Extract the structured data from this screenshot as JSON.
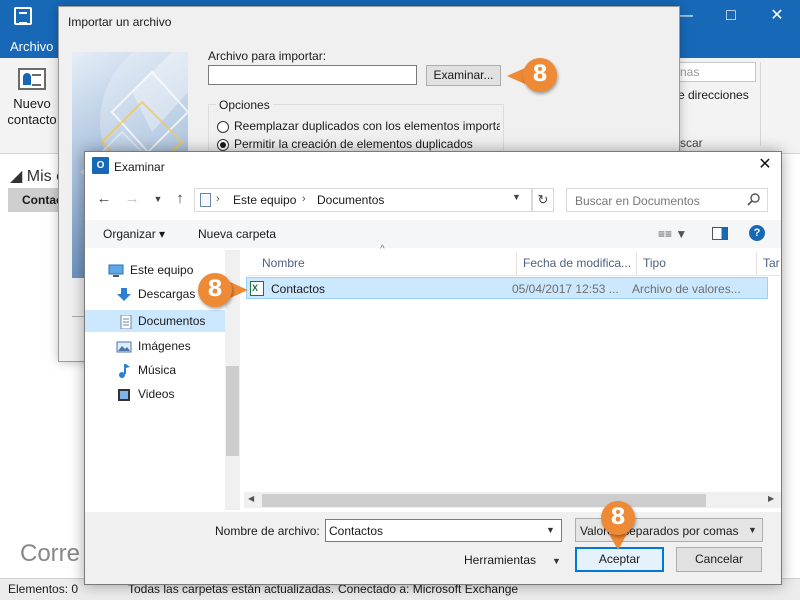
{
  "outlook": {
    "archivo_tab": "Archivo",
    "nuevo_contacto": "Nuevo contacto",
    "ribbon_search_placeholder": "nas",
    "ribbon_direcciones": "e direcciones",
    "ribbon_buscar": "scar",
    "nav_title": "Mis c",
    "nav_contactos": "Contac",
    "correo": "Corre",
    "status": {
      "elementos": "Elementos: 0",
      "carpetas": "Todas las carpetas están actualizadas.",
      "conectado": "Conectado a: Microsoft Exchange"
    }
  },
  "import_dialog": {
    "title": "Importar un archivo",
    "archivo_label": "Archivo para importar:",
    "archivo_value": "",
    "examinar": "Examinar...",
    "opciones": "Opciones",
    "radio1": "Reemplazar duplicados con los elementos importac",
    "radio2": "Permitir la creación de elementos duplicados"
  },
  "browse_dialog": {
    "title": "Examinar",
    "breadcrumb": [
      "Este equipo",
      "Documentos"
    ],
    "search_placeholder": "Buscar en Documentos",
    "toolbar": {
      "organizar": "Organizar ▾",
      "nueva_carpeta": "Nueva carpeta"
    },
    "tree": [
      {
        "label": "Este equipo",
        "icon": "computer-icon"
      },
      {
        "label": "Descargas",
        "icon": "download-icon"
      },
      {
        "label": "Documentos",
        "icon": "document-icon",
        "selected": true
      },
      {
        "label": "Imágenes",
        "icon": "picture-icon"
      },
      {
        "label": "Música",
        "icon": "music-icon"
      },
      {
        "label": "Videos",
        "icon": "video-icon"
      }
    ],
    "columns": [
      "Nombre",
      "Fecha de modifica...",
      "Tipo",
      "Tar"
    ],
    "files": [
      {
        "name": "Contactos",
        "date": "05/04/2017 12:53 ...",
        "type": "Archivo de valores...",
        "icon": "excel-csv-icon"
      }
    ],
    "filename_label": "Nombre de archivo:",
    "filename_value": "Contactos",
    "filetype": "Valores separados por comas",
    "herramientas": "Herramientas",
    "aceptar": "Aceptar",
    "cancelar": "Cancelar"
  },
  "badges": [
    "8",
    "8",
    "8"
  ],
  "colors": {
    "outlook_blue": "#1769b8",
    "badge_orange": "#ee8a35",
    "selection": "#cce8ff"
  }
}
